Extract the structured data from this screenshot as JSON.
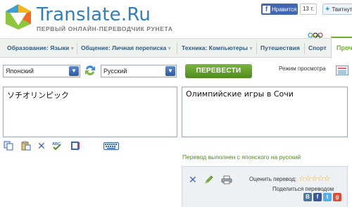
{
  "header": {
    "logo_text": "Translate.Ru",
    "logo_subtitle": "ПЕРВЫЙ ОНЛАЙН-ПЕРЕВОДЧИК РУНЕТА"
  },
  "social": {
    "facebook_like_label": "Нравится",
    "facebook_like_count": "13 т.",
    "twitter_label": "Твитнуть"
  },
  "nav": {
    "items": [
      {
        "label": "Образование: Языки"
      },
      {
        "label": "Общение: Личная переписка"
      },
      {
        "label": "Техника: Компьютеры"
      },
      {
        "label": "Путешествия"
      },
      {
        "label": "Спорт"
      },
      {
        "label": "Проч"
      }
    ]
  },
  "translator": {
    "source_language": "Японский",
    "target_language": "Русский",
    "translate_button": "ПЕРЕВЕСТИ",
    "view_mode_label": "Режим просмотра",
    "source_text": "ソチオリンピック",
    "result_text": "Олимпийские игры в Сочи",
    "status_text": "Перевод выполнен с японского на русский"
  },
  "result_panel": {
    "rate_label": "Оценить перевод:",
    "rating_stars": "☆☆☆☆☆",
    "share_label": "Поделиться переводом"
  },
  "colors": {
    "brand_blue": "#2d7fc1",
    "accent_green": "#6fae2b",
    "nav_text": "#2a5d88"
  }
}
